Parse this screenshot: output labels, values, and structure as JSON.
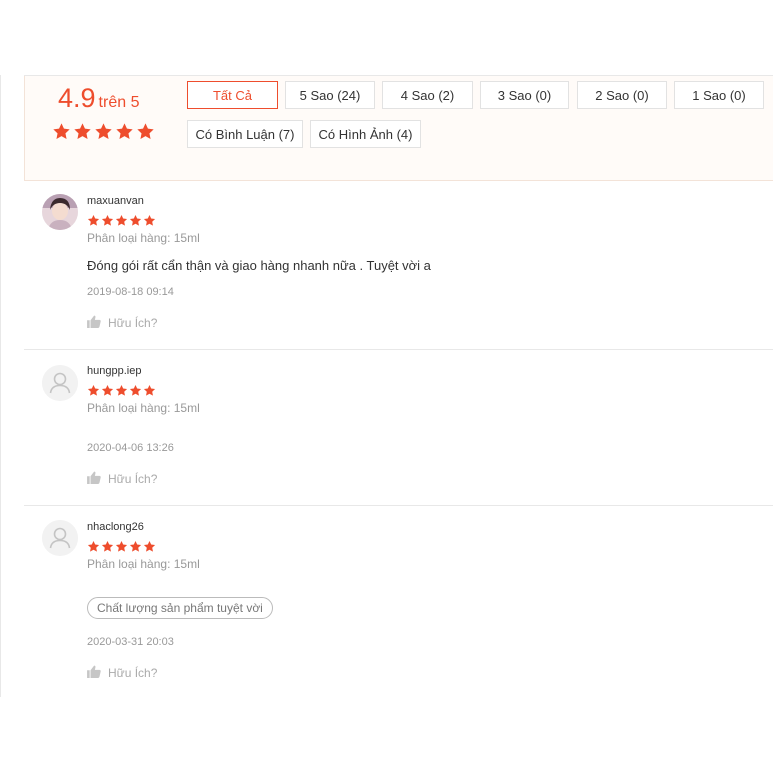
{
  "summary": {
    "rating": "4.9",
    "rating_suffix": "trên 5",
    "stars": 5,
    "accent": "#ee4d2d"
  },
  "filters": [
    {
      "label": "Tất Cả",
      "active": true
    },
    {
      "label": "5 Sao (24)",
      "active": false
    },
    {
      "label": "4 Sao (2)",
      "active": false
    },
    {
      "label": "3 Sao (0)",
      "active": false
    },
    {
      "label": "2 Sao (0)",
      "active": false
    },
    {
      "label": "1 Sao (0)",
      "active": false
    },
    {
      "label": "Có Bình Luận (7)",
      "active": false
    },
    {
      "label": "Có Hình Ảnh (4)",
      "active": false
    }
  ],
  "reviews": [
    {
      "username": "maxuanvan",
      "stars": 5,
      "variant": "Phân loại hàng: 15ml",
      "comment": "Đóng gói rất cẩn thận và giao hàng nhanh nữa . Tuyệt vời a",
      "tag": "",
      "time": "2019-08-18 09:14",
      "helpful": "Hữu Ích?",
      "avatar": "photo"
    },
    {
      "username": "hungpp.iep",
      "stars": 5,
      "variant": "Phân loại hàng: 15ml",
      "comment": "",
      "tag": "",
      "time": "2020-04-06 13:26",
      "helpful": "Hữu Ích?",
      "avatar": "default-user-icon"
    },
    {
      "username": "nhaclong26",
      "stars": 5,
      "variant": "Phân loại hàng: 15ml",
      "comment": "",
      "tag": "Chất lượng sản phẩm tuyệt vời",
      "time": "2020-03-31 20:03",
      "helpful": "Hữu Ích?",
      "avatar": "default-user-icon"
    }
  ]
}
